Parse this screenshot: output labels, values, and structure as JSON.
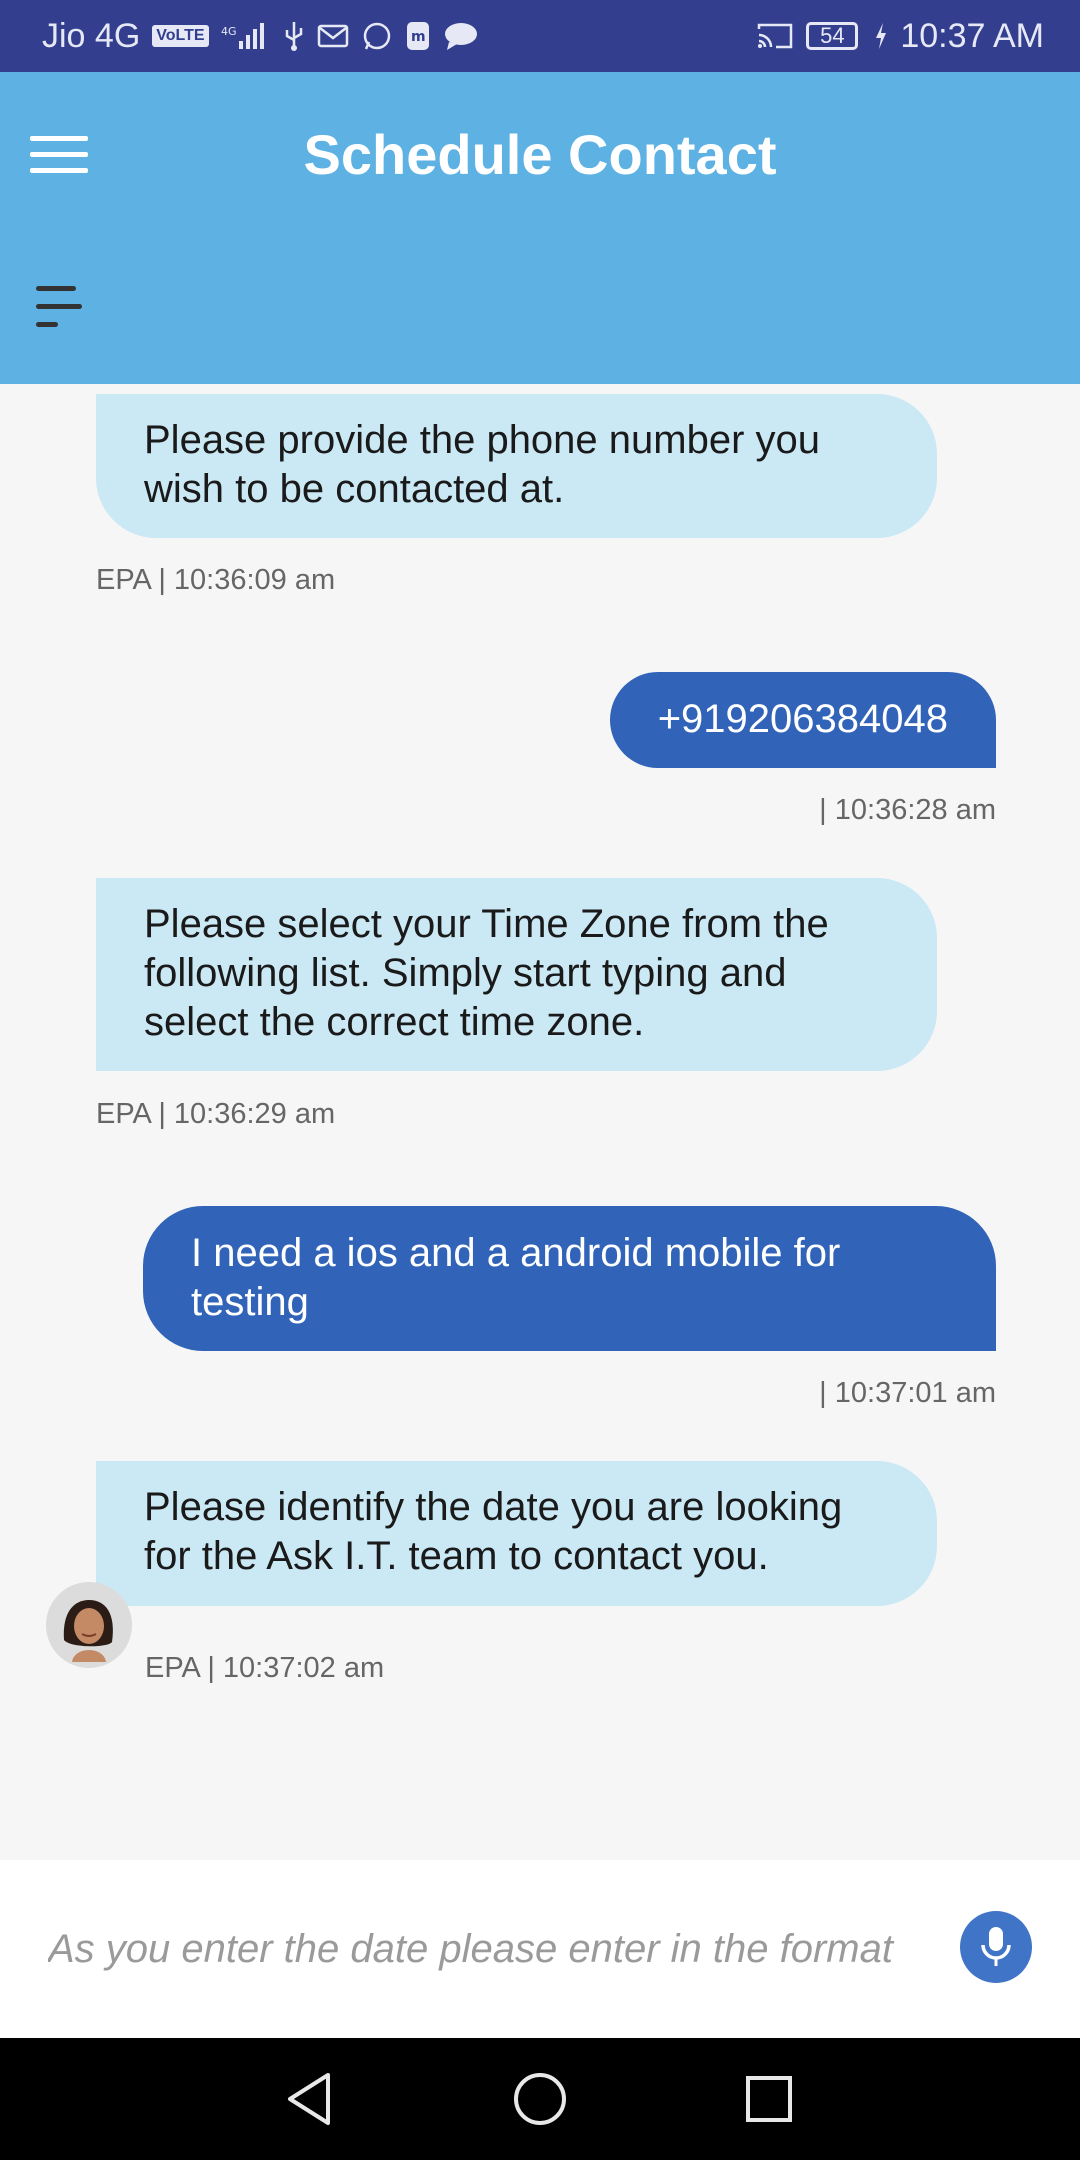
{
  "status_bar": {
    "carrier": "Jio 4G",
    "volte_badge": "VoLTE",
    "battery_level": "54",
    "time": "10:37 AM"
  },
  "header": {
    "title": "Schedule Contact"
  },
  "messages": [
    {
      "sender": "bot",
      "text": "Please provide the phone number you wish to be contacted at.",
      "meta": "EPA | 10:36:09 am"
    },
    {
      "sender": "user",
      "text": "+919206384048",
      "meta": "| 10:36:28 am"
    },
    {
      "sender": "bot",
      "text": "Please select your Time Zone from the following list. Simply start typing and select the correct time zone.",
      "meta": "EPA | 10:36:29 am"
    },
    {
      "sender": "user",
      "text": "I need a ios and a android mobile for testing",
      "meta": "| 10:37:01 am"
    },
    {
      "sender": "bot",
      "text": "Please identify the date you are looking for the Ask I.T. team to contact you.",
      "meta": "EPA | 10:37:02 am"
    }
  ],
  "input": {
    "placeholder": "As you enter the date please enter in the format"
  },
  "colors": {
    "status_bar": "#333f8e",
    "header": "#5db1e3",
    "bot_bubble": "#cbe8f5",
    "user_bubble": "#3164b8",
    "mic_button": "#3f74c7"
  },
  "icons": [
    "hamburger-menu-icon",
    "sort-menu-icon",
    "microphone-icon",
    "back-icon",
    "home-icon",
    "recents-icon"
  ]
}
